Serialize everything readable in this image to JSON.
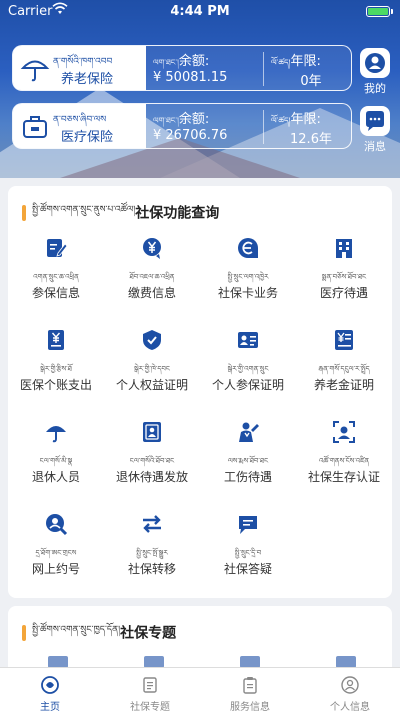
{
  "status": {
    "carrier": "Carrier",
    "time": "4:44 PM"
  },
  "insurance": [
    {
      "tib": "ན་གསོའི་ཁག་འབབ",
      "name": "养老保险",
      "tib_label": "ལག་ཐང་།",
      "balance_label": "余额:",
      "balance": "¥ 50081.15",
      "tib_years": "ལོ་ཚད།",
      "years_label": "年限:",
      "years": "0年"
    },
    {
      "tib": "ན་བཅས་ཞིབ་ལས",
      "name": "医疗保险",
      "tib_label": "ལག་ཐང་།",
      "balance_label": "余额:",
      "balance": "¥ 26706.76",
      "tib_years": "ལོ་ཚད།",
      "years_label": "年限:",
      "years": "12.6年"
    }
  ],
  "side": {
    "mine": "我的",
    "message": "消息"
  },
  "functions": {
    "tib": "སྤྱི་ཚོགས་འགན་སྲུང་ནུས་པ་འཚོལ།",
    "title": "社保功能查询",
    "items": [
      {
        "tib": "འགན་སྲུང་ཆ་འཕྲིན",
        "name": "参保信息",
        "icon": "edit-icon"
      },
      {
        "tib": "ཐོབ་འཇལ་ཆ་འཕྲིན",
        "name": "缴费信息",
        "icon": "yuan-icon"
      },
      {
        "tib": "སྤྱི་སྲུང་ལག་འཁྱེར",
        "name": "社保卡业务",
        "icon": "card-e-icon"
      },
      {
        "tib": "སྨན་བཅོས་ཐོབ་ཐང",
        "name": "医疗待遇",
        "icon": "building-icon"
      },
      {
        "tib": "སྒེར་གྱི་རྩིས་ཐོ",
        "name": "医保个账支出",
        "icon": "yuan-doc-icon"
      },
      {
        "tib": "སྒེར་གྱི་ཁེ་དབང",
        "name": "个人权益证明",
        "icon": "shield-icon"
      },
      {
        "tib": "སྒེར་གྱི་འགན་སྲུང",
        "name": "个人参保证明",
        "icon": "id-card-icon"
      },
      {
        "tib": "རྒན་གསོ་དངུལ་ར་སྤྲོད",
        "name": "养老金证明",
        "icon": "yuan-list-icon"
      },
      {
        "tib": "ངལ་གསོ་མི་སྣ",
        "name": "退休人员",
        "icon": "umbrella-icon"
      },
      {
        "tib": "ངལ་གསོའི་ཐོབ་ཐང",
        "name": "退休待遇发放",
        "icon": "person-doc-icon"
      },
      {
        "tib": "ལས་རྨས་ཐོབ་ཐང",
        "name": "工伤待遇",
        "icon": "worker-icon"
      },
      {
        "tib": "འཚོ་གནས་ངོས་འཛིན",
        "name": "社保生存认证",
        "icon": "face-scan-icon"
      },
      {
        "tib": "དྲ་ཐོག་ཨང་གྲངས",
        "name": "网上约号",
        "icon": "support-icon"
      },
      {
        "tib": "སྤྱི་སྲུང་སྤོ་སྒྱུར",
        "name": "社保转移",
        "icon": "transfer-icon"
      },
      {
        "tib": "སྤྱི་སྲུང་དྲི་བ",
        "name": "社保答疑",
        "icon": "chat-icon"
      }
    ]
  },
  "topics": {
    "tib": "སྤྱི་ཚོགས་འགན་སྲུང་ཁྱད་དོན།",
    "title": "社保专题"
  },
  "tabs": [
    {
      "label": "主页",
      "icon": "home-icon",
      "active": true
    },
    {
      "label": "社保专题",
      "icon": "topic-icon",
      "active": false
    },
    {
      "label": "服务信息",
      "icon": "clipboard-icon",
      "active": false
    },
    {
      "label": "个人信息",
      "icon": "person-icon",
      "active": false
    }
  ],
  "colors": {
    "primary": "#1d4fa5",
    "accent": "#f3a53a",
    "header": "#2b5fc0"
  }
}
